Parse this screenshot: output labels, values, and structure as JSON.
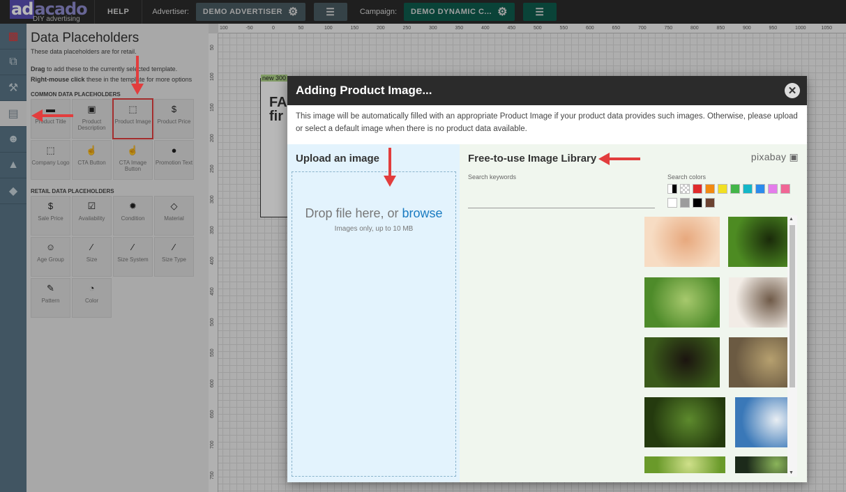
{
  "topbar": {
    "logo_text": "adacado",
    "logo_tagline": "DIY advertising",
    "help_label": "HELP",
    "advertiser_label": "Advertiser:",
    "advertiser_value": "DEMO ADVERTISER",
    "campaign_label": "Campaign:",
    "campaign_value": "DEMO DYNAMIC C..."
  },
  "leftstrip": {
    "items": [
      {
        "icon": "present-icon"
      },
      {
        "icon": "layers-add-icon"
      },
      {
        "icon": "tools-icon"
      },
      {
        "icon": "data-placeholder-icon"
      },
      {
        "icon": "smiley-icon"
      },
      {
        "icon": "stamp-icon"
      },
      {
        "icon": "twitter-icon"
      }
    ]
  },
  "panel": {
    "title": "Data Placeholders",
    "subtitle": "These data placeholders are for retail.",
    "help1_bold": "Drag",
    "help1_text": " to add these to the currently selected template.",
    "help2_bold": "Right-mouse click",
    "help2_text": " these in the template for more options",
    "common_heading": "COMMON DATA PLACEHOLDERS",
    "common": [
      {
        "label": "Product Title",
        "icon": "▬"
      },
      {
        "label": "Product Description",
        "icon": "▣"
      },
      {
        "label": "Product Image",
        "icon": "⬚"
      },
      {
        "label": "Product Price",
        "icon": "$"
      },
      {
        "label": "Company Logo",
        "icon": "⬚"
      },
      {
        "label": "CTA Button",
        "icon": "☝"
      },
      {
        "label": "CTA Image Button",
        "icon": "☝"
      },
      {
        "label": "Promotion Text",
        "icon": "●"
      }
    ],
    "retail_heading": "RETAIL DATA PLACEHOLDERS",
    "retail": [
      {
        "label": "Sale Price",
        "icon": "$"
      },
      {
        "label": "Availability",
        "icon": "☑"
      },
      {
        "label": "Condition",
        "icon": "✹"
      },
      {
        "label": "Material",
        "icon": "◇"
      },
      {
        "label": "Age Group",
        "icon": "☺"
      },
      {
        "label": "Size",
        "icon": "∕"
      },
      {
        "label": "Size System",
        "icon": "∕"
      },
      {
        "label": "Size Type",
        "icon": "∕"
      },
      {
        "label": "Pattern",
        "icon": "✎"
      },
      {
        "label": "Color",
        "icon": "◔"
      }
    ]
  },
  "canvas": {
    "template_name": "new 300",
    "template_text": "FA\nfin",
    "ruler_top": [
      "100",
      "-50",
      "0",
      "50",
      "100",
      "150",
      "200",
      "250",
      "300",
      "350",
      "400",
      "450",
      "500",
      "550",
      "600",
      "650",
      "700",
      "750",
      "800",
      "850",
      "900",
      "950",
      "1000",
      "1050",
      "1100"
    ],
    "ruler_left": [
      "50",
      "100",
      "150",
      "200",
      "250",
      "300",
      "350",
      "400",
      "450",
      "500",
      "550",
      "600",
      "650",
      "700",
      "750"
    ]
  },
  "modal": {
    "title": "Adding Product Image...",
    "description": "This image will be automatically filled with an appropriate Product Image if your product data provides such images. Otherwise, please upload or select a default image when there is no product data available.",
    "upload_heading": "Upload an image",
    "drop_text": "Drop file here, or ",
    "browse_text": "browse",
    "drop_subtext": "Images only, up to 10 MB",
    "library_heading": "Free-to-use Image Library",
    "pixabay_text": "pixabay",
    "search_keywords_label": "Search keywords",
    "search_colors_label": "Search colors",
    "swatches": [
      "#ffffff",
      "#cccccc",
      "#e02b2b",
      "#f28a12",
      "#f1e023",
      "#43b548",
      "#14b7c7",
      "#2b8bec",
      "#e47ceb",
      "#f06695",
      "#ffffff",
      "#9c9c9c",
      "#000000",
      "#6b4331"
    ],
    "images": [
      {
        "name": "hands",
        "colors": [
          "#f7dcc3",
          "#e7a87d"
        ]
      },
      {
        "name": "chameleon",
        "colors": [
          "#4d8b22",
          "#1a2a0a"
        ]
      },
      {
        "name": "dandelion",
        "colors": [
          "#7c8a4a",
          "#2e3a18"
        ]
      },
      {
        "name": "kingfisher",
        "colors": [
          "#4e8b2a",
          "#a7c96d"
        ]
      },
      {
        "name": "blossom",
        "colors": [
          "#f2ece6",
          "#6f5a48"
        ]
      },
      {
        "name": "falcon",
        "colors": [
          "#1a1a1a",
          "#8b6a49"
        ]
      },
      {
        "name": "tulips",
        "colors": [
          "#d9c21a",
          "#1a1a0a"
        ]
      },
      {
        "name": "dog",
        "colors": [
          "#3a5a1a",
          "#1b140f"
        ]
      },
      {
        "name": "buds",
        "colors": [
          "#6b5a42",
          "#b6a06f"
        ]
      },
      {
        "name": "radishes",
        "colors": [
          "#d3273a",
          "#2f6a22"
        ]
      },
      {
        "name": "broken",
        "colors": [
          "#f0f6ee",
          "#f0f6ee"
        ]
      },
      {
        "name": "daisy",
        "colors": [
          "#243a0e",
          "#5d8a2d"
        ]
      },
      {
        "name": "swan",
        "colors": [
          "#3a78b8",
          "#e9eef3"
        ]
      },
      {
        "name": "owl",
        "colors": [
          "#1f3a5a",
          "#6c7f94"
        ]
      },
      {
        "name": "flowers",
        "colors": [
          "#e8e4da",
          "#4e6a2a"
        ]
      },
      {
        "name": "leaf",
        "colors": [
          "#6a9a2a",
          "#cfe08a"
        ]
      },
      {
        "name": "green",
        "colors": [
          "#1c2a1a",
          "#8ab45a"
        ]
      },
      {
        "name": "bread",
        "colors": [
          "#b8772a",
          "#f2d59a"
        ]
      }
    ]
  },
  "colors": {
    "accent_red": "#e23d3d",
    "topbar": "#2b2b2b",
    "upload_bg": "#e3f3fd",
    "library_bg": "#f0f6ee",
    "browse_link": "#1a7bc1"
  }
}
